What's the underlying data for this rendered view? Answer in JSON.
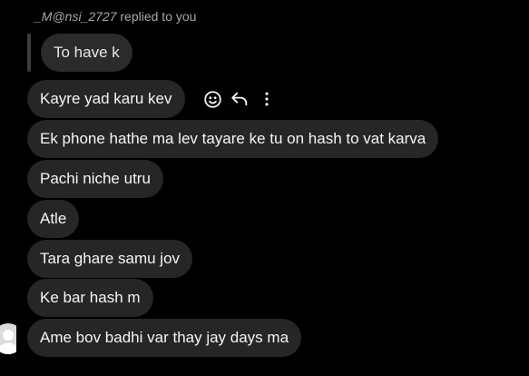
{
  "reply_header": {
    "username": "_M@nsi_2727",
    "action_text": " replied to you"
  },
  "quoted_message": "To have k",
  "messages": [
    "Kayre yad karu kev",
    "Ek phone hathe ma lev tayare ke tu on hash to vat karva",
    "Pachi niche utru",
    "Atle",
    "Tara ghare samu jov",
    "Ke bar hash m",
    "Ame bov badhi var thay jay days ma"
  ],
  "icons": {
    "react": "smiley-face-icon",
    "reply": "reply-arrow-icon",
    "more": "more-options-icon",
    "avatar": "default-avatar-icon"
  },
  "colors": {
    "background": "#000000",
    "bubble": "#262626",
    "text": "#f5f5f5",
    "muted_text": "#a8a8a8"
  }
}
